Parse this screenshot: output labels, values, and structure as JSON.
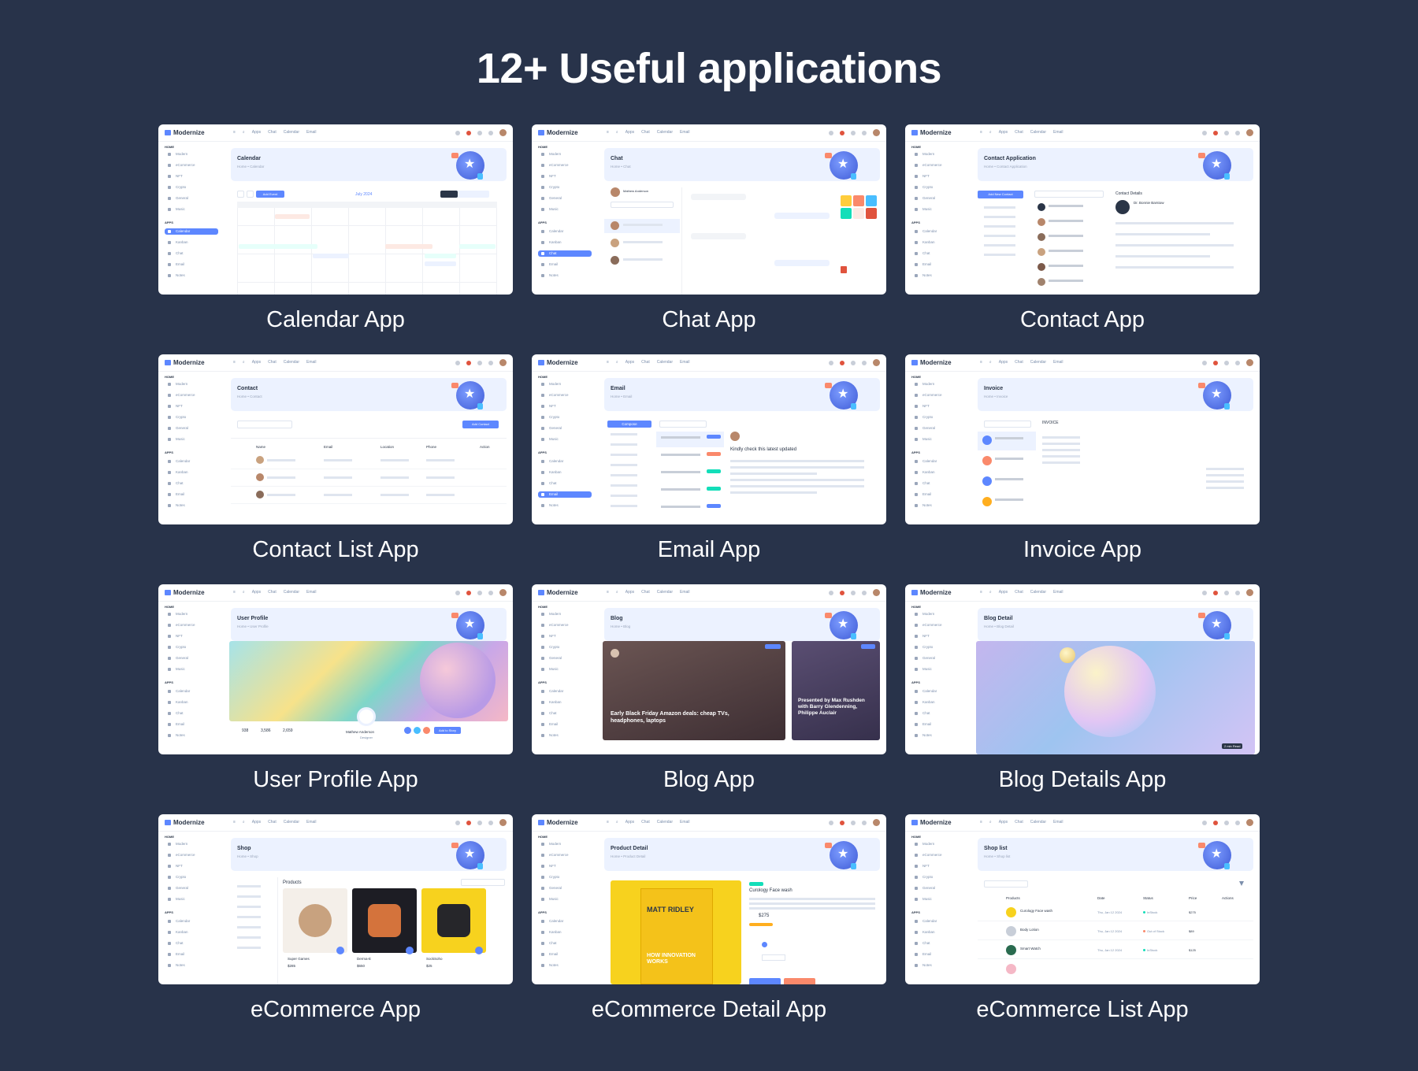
{
  "page": {
    "title": "12+ Useful applications"
  },
  "shared_ui": {
    "brand": "Modernize",
    "nav": [
      "Apps",
      "Chat",
      "Calendar",
      "Email"
    ],
    "sidebar_home_heading": "HOME",
    "sidebar_apps_heading": "APPS",
    "sidebar_home_items": [
      "Modern",
      "eCommerce",
      "NFT",
      "Crypto",
      "General",
      "Music"
    ],
    "sidebar_apps_items": [
      "Calendar",
      "Kanban",
      "Chat",
      "Email",
      "Notes"
    ]
  },
  "apps": [
    {
      "label": "Calendar App",
      "header_title": "Calendar",
      "crumb": "Home • Calendar",
      "active": "Calendar",
      "type": "calendar",
      "month": "July 2024",
      "add_label": "Add Event"
    },
    {
      "label": "Chat App",
      "header_title": "Chat",
      "crumb": "Home • Chat",
      "active": "Chat",
      "type": "chat",
      "user": "Mathew Anderson"
    },
    {
      "label": "Contact App",
      "header_title": "Contact Application",
      "crumb": "Home • Contact Application",
      "active": "",
      "type": "contact",
      "add_label": "Add New Contact",
      "detail_title": "Contact Details",
      "person": "Dr. Bonnie Barstow"
    },
    {
      "label": "Contact List App",
      "header_title": "Contact",
      "crumb": "Home • Contact",
      "active": "",
      "type": "contactlist",
      "add_label": "Add Contact",
      "columns": [
        "Name",
        "Email",
        "Location",
        "Phone",
        "Action"
      ]
    },
    {
      "label": "Email App",
      "header_title": "Email",
      "crumb": "Home • Email",
      "active": "Email",
      "type": "email",
      "compose": "Compose",
      "subject": "Kindly check this latest updated"
    },
    {
      "label": "Invoice App",
      "header_title": "Invoice",
      "crumb": "Home • Invoice",
      "active": "",
      "type": "invoice",
      "doc_title": "INVOICE"
    },
    {
      "label": "User Profile App",
      "header_title": "User Profile",
      "crumb": "Home • User Profile",
      "active": "",
      "type": "profile",
      "name": "Mathew Anderson",
      "role": "Designer",
      "stats": [
        "938",
        "3,586",
        "2,659"
      ],
      "button": "Add to Story"
    },
    {
      "label": "Blog App",
      "header_title": "Blog",
      "crumb": "Home • Blog",
      "active": "",
      "type": "blog",
      "post1": "Early Black Friday Amazon deals: cheap TVs, headphones, laptops",
      "post2": "Presented by Max Rushden with Barry Glendenning, Philippe Auclair",
      "tag1": "Gadget",
      "tag2": "Health"
    },
    {
      "label": "Blog Details App",
      "header_title": "Blog Detail",
      "crumb": "Home • Blog Detail",
      "active": "",
      "type": "blogdetail",
      "tag": "2 min Read"
    },
    {
      "label": "eCommerce App",
      "header_title": "Shop",
      "crumb": "Home • Shop",
      "active": "",
      "type": "shop",
      "section": "Products",
      "products": [
        "Super Games",
        "Derma-E",
        "SockSoho"
      ],
      "prices": [
        "$285",
        "$650",
        "$25"
      ]
    },
    {
      "label": "eCommerce Detail App",
      "header_title": "Product Detail",
      "crumb": "Home • Product Detail",
      "active": "",
      "type": "productdetail",
      "book_title": "MATT RIDLEY",
      "book_sub": "HOW INNOVATION WORKS",
      "product_name": "Curology Face wash",
      "price": "$275"
    },
    {
      "label": "eCommerce List App",
      "header_title": "Shop list",
      "crumb": "Home • Shop list",
      "active": "",
      "type": "shoplist",
      "columns": [
        "Products",
        "Date",
        "Status",
        "Price",
        "Actions"
      ],
      "rows": [
        [
          "Curology Face wash",
          "Thu, Jan 12 2024",
          "InStock",
          "$275"
        ],
        [
          "Body Lotion",
          "Thu, Jan 12 2024",
          "Out of Stock",
          "$89"
        ],
        [
          "Smart Watch",
          "Thu, Jan 12 2024",
          "InStock",
          "$125"
        ]
      ]
    }
  ]
}
